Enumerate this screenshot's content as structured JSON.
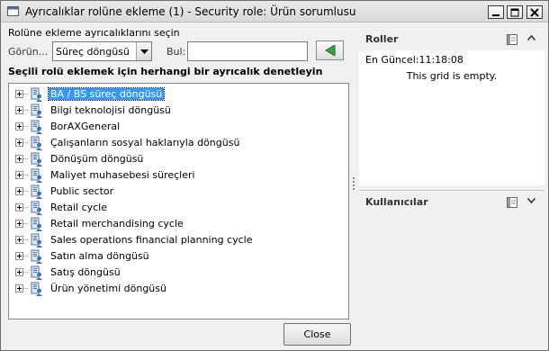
{
  "window": {
    "title": "Ayrıcalıklar rolüne ekleme (1) - Security role: Ürün sorumlusu"
  },
  "left": {
    "subtitle": "Rolüne ekleme ayrıcalıklarını seçin",
    "view_label": "Görün...",
    "view_value": "Süreç döngüsü",
    "find_label": "Bul:",
    "find_value": "",
    "instruction": "Seçili rolü eklemek için herhangi bir ayrıcalık denetleyin",
    "tree_items": [
      {
        "label": "BA / BS süreç döngüsü",
        "selected": true
      },
      {
        "label": "Bilgi teknolojisi döngüsü"
      },
      {
        "label": "BorAXGeneral"
      },
      {
        "label": "Çalışanların sosyal haklarıyla döngüsü"
      },
      {
        "label": "Dönüşüm döngüsü"
      },
      {
        "label": "Maliyet muhasebesi süreçleri"
      },
      {
        "label": "Public sector"
      },
      {
        "label": "Retail cycle"
      },
      {
        "label": "Retail merchandising cycle"
      },
      {
        "label": "Sales operations financial planning cycle"
      },
      {
        "label": "Satın alma döngüsü"
      },
      {
        "label": "Satış döngüsü"
      },
      {
        "label": "Ürün yönetimi döngüsü"
      }
    ],
    "close_label": "Close"
  },
  "right": {
    "roller": {
      "title": "Roller",
      "last_updated": "En Güncel:11:18:08",
      "empty_message": "This grid is empty."
    },
    "users": {
      "title": "Kullanıcılar"
    }
  },
  "colors": {
    "selection": "#3399ff",
    "add_arrow": "#3aa63a"
  }
}
